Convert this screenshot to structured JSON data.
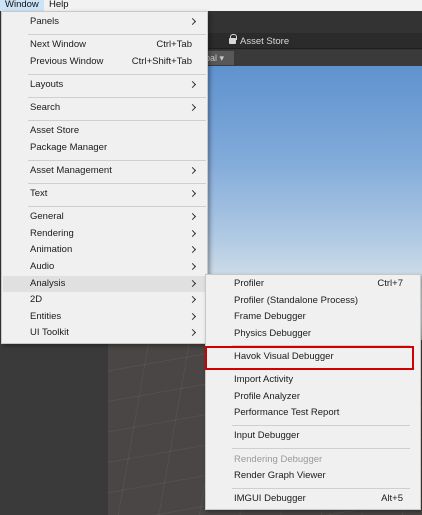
{
  "menubar": {
    "window_label": "Window",
    "help_label": "Help"
  },
  "editor": {
    "asset_store_tab": "Asset Store",
    "global_dropdown": "bal ▾"
  },
  "window_menu": {
    "items": [
      {
        "label": "Panels",
        "submenu": true
      },
      {
        "label": "Next Window",
        "shortcut": "Ctrl+Tab"
      },
      {
        "label": "Previous Window",
        "shortcut": "Ctrl+Shift+Tab"
      },
      {
        "label": "Layouts",
        "submenu": true
      },
      {
        "label": "Search",
        "submenu": true
      },
      {
        "label": "Asset Store"
      },
      {
        "label": "Package Manager"
      },
      {
        "label": "Asset Management",
        "submenu": true
      },
      {
        "label": "Text",
        "submenu": true
      },
      {
        "label": "General",
        "submenu": true
      },
      {
        "label": "Rendering",
        "submenu": true
      },
      {
        "label": "Animation",
        "submenu": true
      },
      {
        "label": "Audio",
        "submenu": true
      },
      {
        "label": "Analysis",
        "submenu": true,
        "highlighted": true
      },
      {
        "label": "2D",
        "submenu": true
      },
      {
        "label": "Entities",
        "submenu": true
      },
      {
        "label": "UI Toolkit",
        "submenu": true
      }
    ]
  },
  "analysis_menu": {
    "items": [
      {
        "label": "Profiler",
        "shortcut": "Ctrl+7"
      },
      {
        "label": "Profiler (Standalone Process)"
      },
      {
        "label": "Frame Debugger"
      },
      {
        "label": "Physics Debugger"
      },
      {
        "label": "Havok Visual Debugger",
        "outlined": true
      },
      {
        "label": "Import Activity"
      },
      {
        "label": "Profile Analyzer"
      },
      {
        "label": "Performance Test Report"
      },
      {
        "label": "Input Debugger"
      },
      {
        "label": "Rendering Debugger",
        "disabled": true
      },
      {
        "label": "Render Graph Viewer"
      },
      {
        "label": "IMGUI Debugger",
        "shortcut": "Alt+5"
      }
    ]
  },
  "colors": {
    "highlight_outline": "#d00000",
    "menu_bg": "#f0f0f0"
  }
}
